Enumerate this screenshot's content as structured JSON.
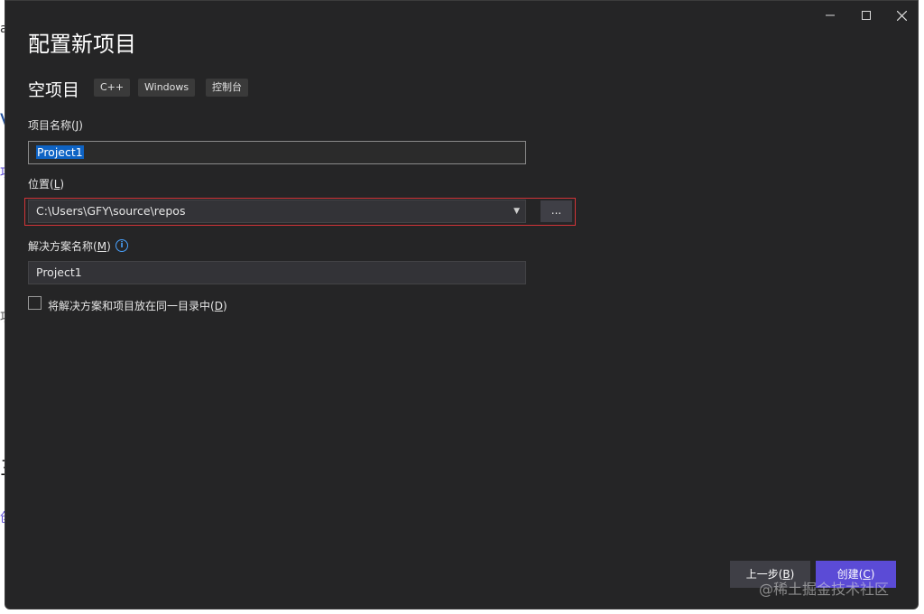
{
  "window": {
    "title": "配置新项目",
    "controls": {
      "minimize_icon": "minimize-icon",
      "maximize_icon": "maximize-icon",
      "close_icon": "close-icon"
    }
  },
  "project_type": {
    "name": "空项目",
    "tags": [
      "C++",
      "Windows",
      "控制台"
    ]
  },
  "project_name": {
    "label": "项目名称",
    "accesskey": "J",
    "value": "Project1"
  },
  "location": {
    "label": "位置",
    "accesskey": "L",
    "value": "C:\\Users\\GFY\\source\\repos",
    "browse_label": "..."
  },
  "solution_name": {
    "label": "解决方案名称",
    "accesskey": "M",
    "value": "Project1",
    "info_icon": "info-icon"
  },
  "same_dir_checkbox": {
    "label": "将解决方案和项目放在同一目录中",
    "accesskey": "D",
    "checked": false
  },
  "buttons": {
    "back": {
      "label": "上一步",
      "accesskey": "B"
    },
    "create": {
      "label": "创建",
      "accesskey": "C"
    }
  },
  "watermark": "@稀土掘金技术社区",
  "colors": {
    "accent": "#5b4bd6",
    "highlight_border": "#d13438",
    "selection": "#0e63c4"
  }
}
